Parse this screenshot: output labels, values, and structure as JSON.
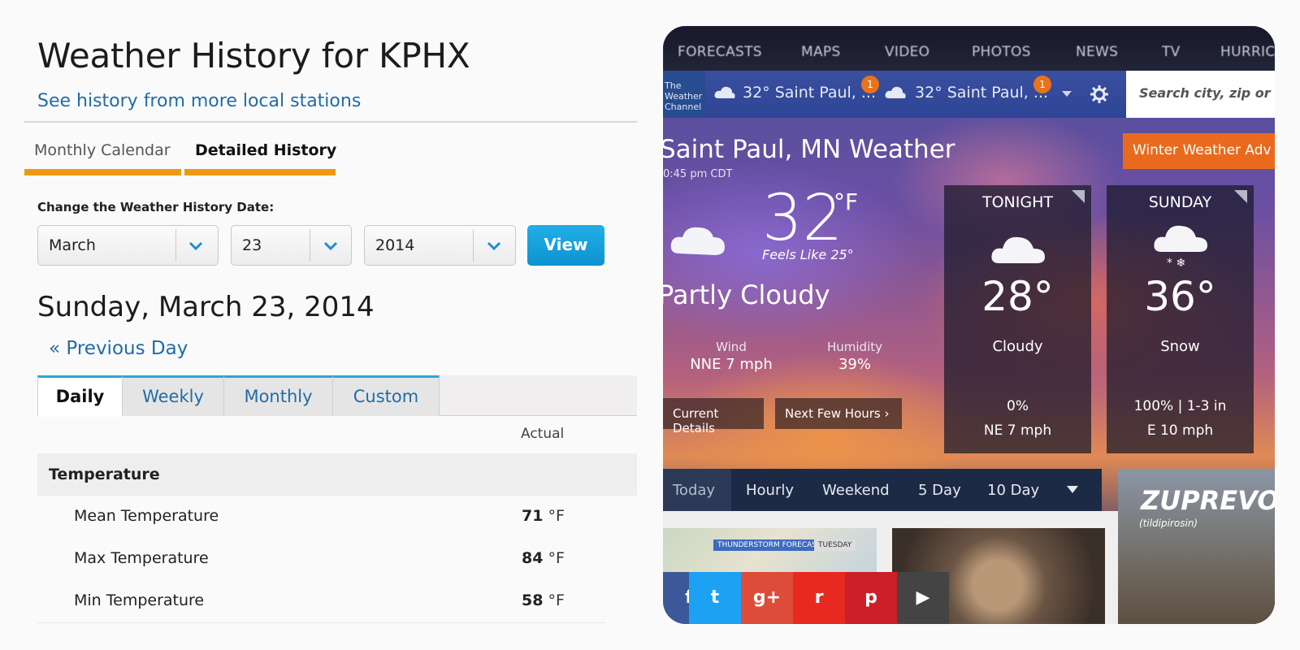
{
  "history": {
    "title": "Weather History for KPHX",
    "more_stations_link": "See history from more local stations",
    "tabs": [
      "Monthly Calendar",
      "Detailed History"
    ],
    "change_date_label": "Change the Weather History Date:",
    "month": "March",
    "day": "23",
    "year": "2014",
    "view_button": "View",
    "date_heading": "Sunday, March 23, 2014",
    "previous_day": "« Previous Day",
    "range_tabs": [
      "Daily",
      "Weekly",
      "Monthly",
      "Custom"
    ],
    "column_header": "Actual",
    "section": "Temperature",
    "rows": [
      {
        "label": "Mean Temperature",
        "value": "71",
        "unit": "°F"
      },
      {
        "label": "Max Temperature",
        "value": "84",
        "unit": "°F"
      },
      {
        "label": "Min Temperature",
        "value": "58",
        "unit": "°F"
      }
    ]
  },
  "twc": {
    "nav": [
      "FORECASTS",
      "MAPS",
      "VIDEO",
      "PHOTOS",
      "NEWS",
      "TV",
      "HURRIC"
    ],
    "logo": "The Weather Channel",
    "locations": [
      {
        "label": "32° Saint Paul, ...",
        "badge": "1"
      },
      {
        "label": "32° Saint Paul, ...",
        "badge": "1"
      }
    ],
    "search_placeholder": "Search city, zip or pla",
    "city_title": "Saint Paul, MN Weather",
    "time": "0:45 pm CDT",
    "alert": "Winter Weather Adv",
    "current_temp": "32",
    "temp_unit": "°F",
    "feels_like": "Feels Like 25°",
    "condition": "Partly Cloudy",
    "wind_label": "Wind",
    "wind_value": "NNE 7 mph",
    "humidity_label": "Humidity",
    "humidity_value": "39%",
    "current_details": "Current Details",
    "next_hours": "Next Few Hours ›",
    "forecast": [
      {
        "period": "TONIGHT",
        "temp": "28°",
        "cond": "Cloudy",
        "precip": "0%",
        "wind": "NE 7 mph",
        "icon": "cloud-icon"
      },
      {
        "period": "SUNDAY",
        "temp": "36°",
        "cond": "Snow",
        "precip": "100% | 1-3 in",
        "wind": "E 10 mph",
        "icon": "snow-cloud-icon"
      }
    ],
    "day_tabs": [
      "Today",
      "Hourly",
      "Weekend",
      "5 Day",
      "10 Day"
    ],
    "ad_title": "ZUPREVO",
    "ad_sub": "(tildipirosin)",
    "map_chip_1": "THUNDERSTORM FORECAST",
    "map_chip_2": "TUESDAY",
    "social": [
      "f",
      "t",
      "g+",
      "r",
      "p",
      "▶"
    ],
    "social_colors": [
      "#3b5998",
      "#1da1f2",
      "#dd4b39",
      "#e8291f",
      "#cb2027",
      "#444444"
    ]
  }
}
